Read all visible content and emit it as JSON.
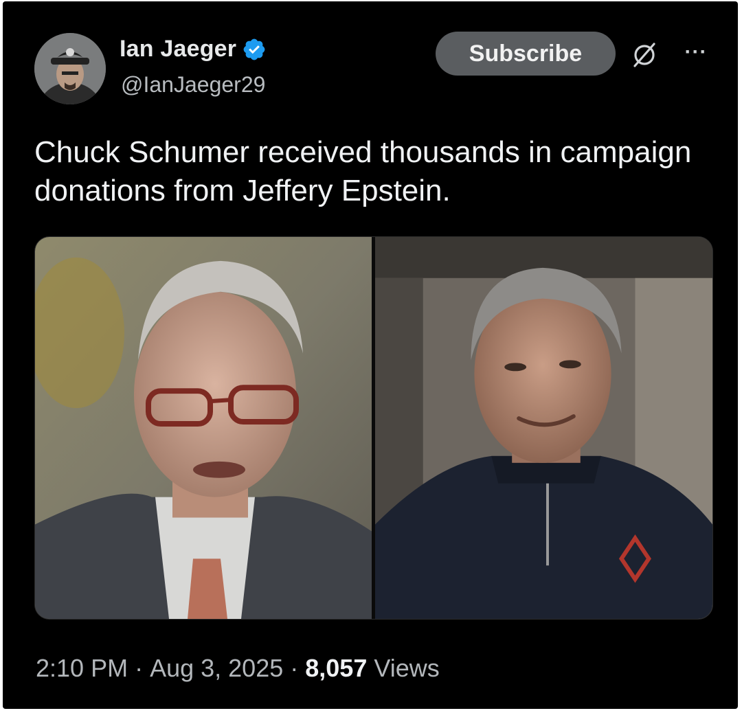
{
  "author": {
    "display_name": "Ian Jaeger",
    "handle": "@IanJaeger29",
    "verified_icon": "verified-badge-icon",
    "verified_color": "#1d9bf0"
  },
  "actions": {
    "subscribe_label": "Subscribe",
    "grok_icon": "grok-icon",
    "more_label": "···"
  },
  "tweet": {
    "text": "Chuck Schumer received thousands in campaign donations from Jeffery Epstein."
  },
  "media": {
    "images": [
      "left-portrait-photo",
      "right-portrait-photo"
    ]
  },
  "meta": {
    "time": "2:10 PM",
    "separator": "·",
    "date": "Aug 3, 2025",
    "views_count": "8,057",
    "views_label": "Views"
  }
}
